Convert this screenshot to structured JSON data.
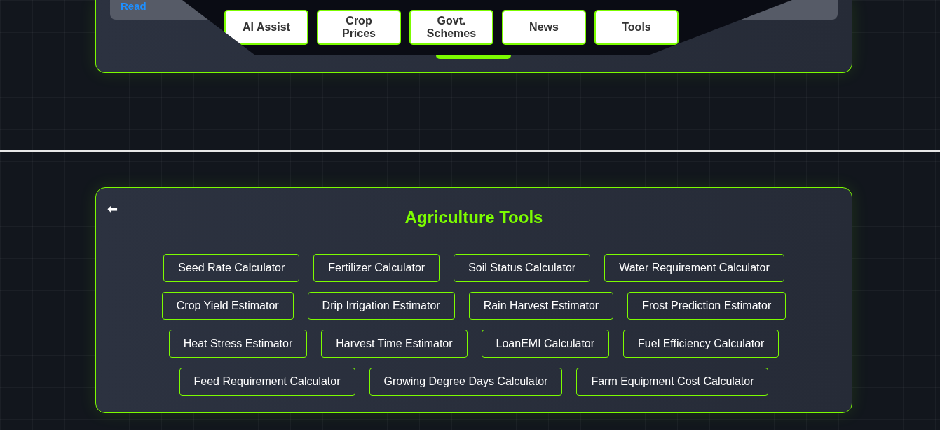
{
  "top_card": {
    "link": "Read"
  },
  "nav": [
    {
      "label": "AI Assist"
    },
    {
      "label": "Crop Prices"
    },
    {
      "label": "Govt. Schemes"
    },
    {
      "label": "News"
    },
    {
      "label": "Tools"
    }
  ],
  "tools_panel": {
    "back": "⬅",
    "title": "Agriculture Tools",
    "tools": [
      "Seed Rate Calculator",
      "Fertilizer Calculator",
      "Soil Status Calculator",
      "Water Requirement Calculator",
      "Crop Yield Estimator",
      "Drip Irrigation Estimator",
      "Rain Harvest Estimator",
      "Frost Prediction Estimator",
      "Heat Stress Estimator",
      "Harvest Time Estimator",
      "LoanEMI Calculator",
      "Fuel Efficiency Calculator",
      "Feed Requirement Calculator",
      "Growing Degree Days Calculator",
      "Farm Equipment Cost Calculator"
    ]
  }
}
